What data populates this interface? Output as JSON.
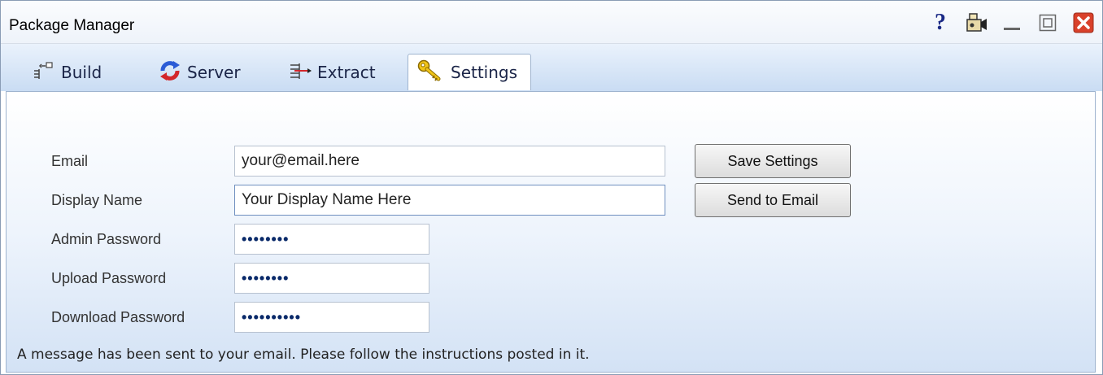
{
  "window": {
    "title": "Package Manager",
    "help_glyph": "?",
    "icons": [
      "help-icon",
      "camera-icon",
      "minimize-icon",
      "maximize-icon",
      "close-icon"
    ]
  },
  "tabs": [
    {
      "label": "Build",
      "icon": "build-icon"
    },
    {
      "label": "Server",
      "icon": "refresh-icon"
    },
    {
      "label": "Extract",
      "icon": "extract-icon"
    },
    {
      "label": "Settings",
      "icon": "key-icon",
      "active": true
    }
  ],
  "form": {
    "email_label": "Email",
    "email_value": "your@email.here",
    "display_name_label": "Display Name",
    "display_name_value": "Your Display Name Here",
    "admin_password_label": "Admin Password",
    "admin_password_mask": "••••••••",
    "upload_password_label": "Upload Password",
    "upload_password_mask": "••••••••",
    "download_password_label": "Download Password",
    "download_password_mask": "••••••••••"
  },
  "buttons": {
    "save_settings": "Save Settings",
    "send_to_email": "Send to Email"
  },
  "status_message": "A message has been sent to your email. Please follow the instructions posted in it.",
  "colors": {
    "close_red": "#d9412b",
    "refresh_red": "#d3262b",
    "refresh_blue": "#2a5bd6",
    "key_yellow": "#f0c419"
  }
}
